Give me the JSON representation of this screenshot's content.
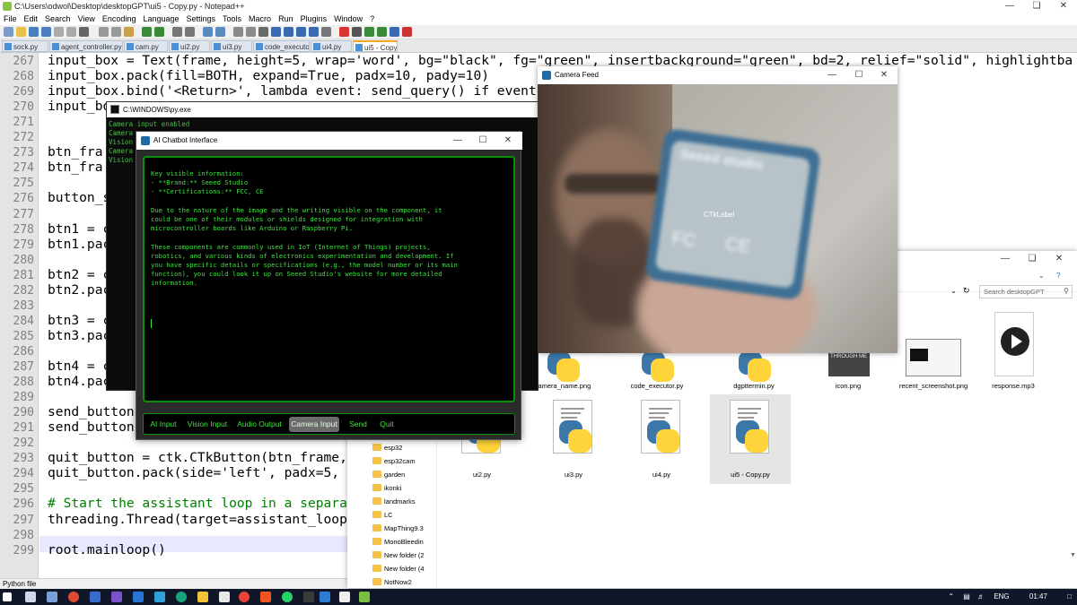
{
  "notepad": {
    "title": "C:\\Users\\odwol\\Desktop\\desktopGPT\\ui5 - Copy.py - Notepad++",
    "menu": [
      "File",
      "Edit",
      "Search",
      "View",
      "Encoding",
      "Language",
      "Settings",
      "Tools",
      "Macro",
      "Run",
      "Plugins",
      "Window",
      "?"
    ],
    "tabs": [
      "sock.py",
      "agent_controller.py",
      "cam.py",
      "ui2.py",
      "ui3.py",
      "code_executor.py",
      "ui4.py",
      "ui5 - Copy.py"
    ],
    "active_tab": "ui5 - Copy.py",
    "line_numbers": [
      "267",
      "268",
      "269",
      "270",
      "271",
      "272",
      "273",
      "274",
      "275",
      "276",
      "277",
      "278",
      "279",
      "280",
      "281",
      "282",
      "283",
      "284",
      "285",
      "286",
      "287",
      "288",
      "289",
      "290",
      "291",
      "292",
      "293",
      "294",
      "295",
      "296",
      "297",
      "298",
      "299"
    ],
    "code": [
      "input_box = Text(frame, height=5, wrap='word', bg=\"black\", fg=\"green\", insertbackground=\"green\", bd=2, relief=\"solid\", highlightba",
      "input_box.pack(fill=BOTH, expand=True, padx=10, pady=10)",
      "input_box.bind('<Return>', lambda event: send_query() if event.",
      "input_bo",
      "",
      "",
      "btn_fra",
      "btn_fra",
      "",
      "button_s",
      "",
      "btn1 = c",
      "btn1.pac",
      "",
      "btn2 = c",
      "btn2.pac",
      "",
      "btn3 = c",
      "btn3.pac",
      "",
      "btn4 = c",
      "btn4.pac",
      "",
      "send_button",
      "send_button",
      "",
      "quit_button = ctk.CTkButton(btn_frame,",
      "quit_button.pack(side='left', padx=5, p",
      "",
      "# Start the assistant loop in a separat",
      "threading.Thread(target=assistant_loop)",
      "",
      "root.mainloop()"
    ],
    "status": "Python file"
  },
  "console": {
    "title": "C:\\WINDOWS\\py.exe",
    "lines": [
      "Camera input enabled",
      "Camera",
      "Vision",
      "Camera",
      "Vision"
    ]
  },
  "chat": {
    "title": "AI Chatbot Interface",
    "text_lines": [
      "Key visible information:",
      "- **Brand:** Seeed Studio",
      "- **Certifications:** FCC, CE",
      "",
      "Due to the nature of the image and the writing visible on the component, it",
      "could be one of their modules or shields designed for integration with",
      "microcontroller boards like Arduino or Raspberry Pi.",
      "",
      "These components are commonly used in IoT (Internet of Things) projects,",
      "robotics, and various kinds of electronics experimentation and development. If",
      "you have specific details or specifications (e.g., the model number or its main",
      "function), you could look it up on Seeed Studio's website for more detailed",
      "information."
    ],
    "buttons": [
      "AI Input",
      "Vision Input",
      "Audio Output",
      "Camera Input",
      "Send",
      "Quit"
    ],
    "active_button": "Camera Input"
  },
  "camera": {
    "title": "Camera Feed",
    "label": "CTkLabel",
    "board_text": [
      "Seeed studio",
      "FC",
      "CE"
    ]
  },
  "explorer": {
    "search_placeholder": "Search desktopGPT",
    "folders": [
      "esp32",
      "esp32cam",
      "garden",
      "ikonki",
      "landmarks",
      "LC",
      "MapThing9.3",
      "MonoBleedin",
      "New folder (2",
      "New folder (4",
      "NotNow2"
    ],
    "top_files": [
      "camera_name.png",
      "code_executor.py",
      "dgpttermin.py",
      "icon.png",
      "recent_screenshot.png",
      "response.mp3"
    ],
    "py_files": [
      "ui2.py",
      "ui3.py",
      "ui4.py",
      "ui5 - Copy.py"
    ],
    "thumb_text": "THROUGH ME"
  },
  "taskbar": {
    "lang": "ENG",
    "time": "01:47"
  }
}
